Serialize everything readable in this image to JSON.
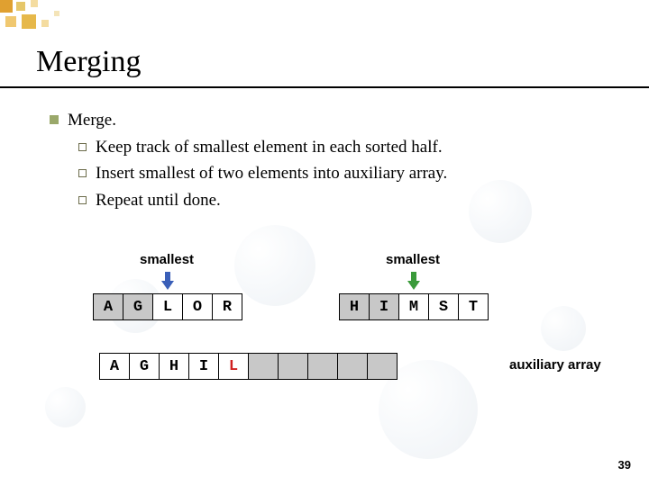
{
  "title": "Merging",
  "bullets": {
    "main": "Merge.",
    "subs": [
      "Keep track of smallest element in each sorted half.",
      "Insert smallest of two elements into auxiliary array.",
      "Repeat until done."
    ]
  },
  "labels": {
    "smallest_left": "smallest",
    "smallest_right": "smallest",
    "auxiliary": "auxiliary array"
  },
  "arrays": {
    "left": [
      "A",
      "G",
      "L",
      "O",
      "R"
    ],
    "right": [
      "H",
      "I",
      "M",
      "S",
      "T"
    ],
    "aux": [
      "A",
      "G",
      "H",
      "I",
      "L",
      "",
      "",
      "",
      "",
      ""
    ]
  },
  "highlights": {
    "left_gray_count": 2,
    "right_gray_count": 2,
    "aux_latest_index": 4,
    "arrow_left_index": 2,
    "arrow_right_index": 2
  },
  "page_number": "39"
}
